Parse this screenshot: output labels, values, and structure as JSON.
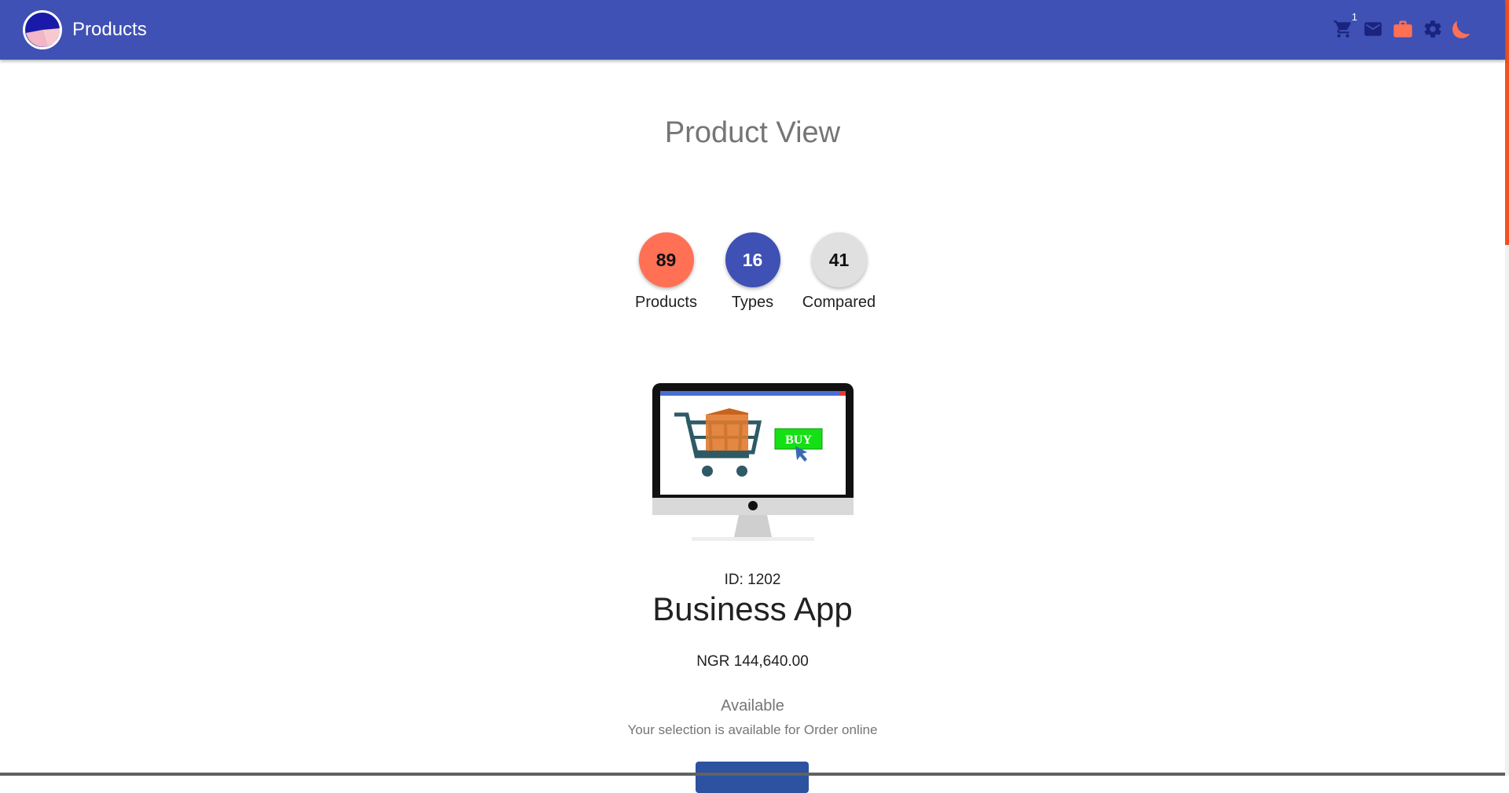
{
  "app": {
    "title": "Products",
    "cart_count": "1"
  },
  "icons": {
    "logo": "pie-chart-logo",
    "cart": "cart-icon",
    "mail": "mail-icon",
    "briefcase": "briefcase-icon",
    "settings": "gear-icon",
    "theme": "moon-icon"
  },
  "colors": {
    "appbar": "#3f51b5",
    "accent": "#ff7055",
    "primary": "#3f51b5",
    "neutral": "#e0e0e0"
  },
  "page": {
    "heading": "Product View"
  },
  "stats": [
    {
      "value": "89",
      "label": "Products"
    },
    {
      "value": "16",
      "label": "Types"
    },
    {
      "value": "41",
      "label": "Compared"
    }
  ],
  "product": {
    "id_text": "ID: 1202",
    "name": "Business App",
    "price": "NGR 144,640.00",
    "status": "Available",
    "status_note": "Your selection is available for Order online",
    "image_button_text": "BUY"
  }
}
